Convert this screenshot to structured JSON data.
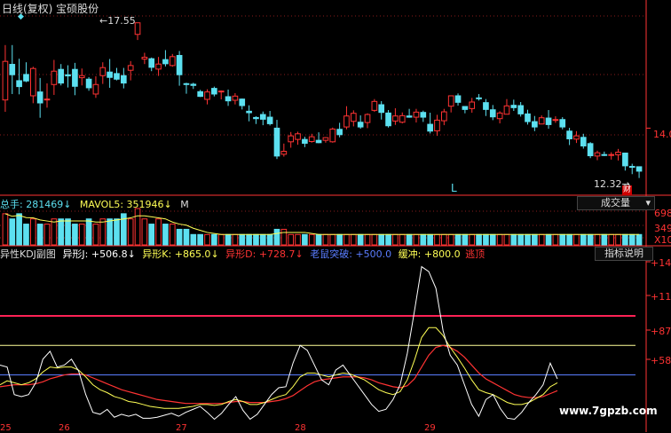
{
  "chart_title": "日线(复权)  宝硕股份",
  "price": {
    "high_label": "17.55",
    "low_label": "12.32",
    "axis_value": "14.0",
    "axis_values": [
      14.0
    ],
    "ylim": [
      11.8,
      17.9
    ],
    "marker_cai": "财",
    "marker_l": "L"
  },
  "volume": {
    "legend_total": "总手: 281469",
    "legend_mavol5": "MAVOL5: 351946",
    "legend_m": "M",
    "button": "成交量",
    "axis": [
      "698",
      "349",
      "X10"
    ]
  },
  "indicator": {
    "title": "异性KDJ副图",
    "legend": [
      {
        "text": "异形J: +506.8",
        "color": "#ffffff"
      },
      {
        "text": "异形K: +865.0",
        "color": "#ffff55"
      },
      {
        "text": "异形D: +728.7",
        "color": "#ff3333"
      },
      {
        "text": "老鼠突破: +500.0",
        "color": "#5a7dff"
      },
      {
        "text": "缓冲: +800.0",
        "color": "#ffff55"
      },
      {
        "text": "逃顶",
        "color": "#ff3333"
      }
    ],
    "button": "指标说明",
    "axis": [
      "+14",
      "+11",
      "+87",
      "+58"
    ]
  },
  "x_axis": [
    "25",
    "26",
    "27",
    "28",
    "29"
  ],
  "watermark": "www.7gpzb.com",
  "colors": {
    "up": "#ff3333",
    "down": "#5ce0f0",
    "grid": "#8a1c1c",
    "axis": "#ff3333"
  },
  "candles": [
    [
      14.95,
      16.25,
      14.55,
      16.8
    ],
    [
      16.15,
      15.8,
      15.15,
      16.8
    ],
    [
      15.6,
      15.4,
      15.14,
      16.34
    ],
    [
      15.81,
      15.59,
      15.55,
      16.22
    ],
    [
      15.09,
      16.01,
      14.84,
      16.07
    ],
    [
      15.22,
      14.85,
      14.35,
      15.69
    ],
    [
      14.95,
      14.98,
      14.69,
      15.51
    ],
    [
      15.47,
      15.92,
      15.12,
      16.3
    ],
    [
      15.98,
      15.52,
      15.44,
      16.16
    ],
    [
      15.8,
      15.76,
      15.37,
      16.12
    ],
    [
      15.98,
      15.41,
      15.11,
      16.2
    ],
    [
      15.7,
      15.77,
      15.44,
      16.01
    ],
    [
      15.65,
      15.36,
      15.26,
      15.72
    ],
    [
      15.15,
      15.47,
      15.02,
      15.75
    ],
    [
      15.77,
      16.04,
      15.49,
      16.22
    ],
    [
      15.89,
      15.71,
      15.36,
      16.33
    ],
    [
      15.84,
      15.65,
      15.61,
      16.03
    ],
    [
      15.77,
      15.52,
      15.34,
      16.03
    ],
    [
      15.95,
      16.11,
      15.61,
      16.26
    ],
    [
      17.16,
      17.55,
      16.97,
      17.55
    ],
    [
      16.33,
      16.39,
      16.16,
      16.54
    ],
    [
      16.34,
      16.05,
      15.92,
      16.38
    ],
    [
      15.99,
      16.16,
      15.76,
      16.4
    ],
    [
      16.31,
      16.17,
      16.08,
      16.63
    ],
    [
      16.11,
      16.41,
      16.07,
      16.5
    ],
    [
      16.45,
      15.8,
      15.43,
      16.6
    ],
    [
      15.5,
      15.47,
      15.16,
      15.53
    ],
    [
      15.48,
      15.44,
      15.32,
      15.53
    ],
    [
      15.23,
      15.07,
      15.05,
      15.29
    ],
    [
      14.97,
      15.22,
      14.8,
      15.31
    ],
    [
      15.34,
      15.15,
      15.07,
      15.4
    ],
    [
      15.22,
      15.25,
      14.97,
      15.27
    ],
    [
      15.06,
      14.92,
      14.75,
      15.3
    ],
    [
      14.94,
      15.08,
      14.8,
      15.18
    ],
    [
      14.98,
      14.76,
      14.63,
      15.0
    ],
    [
      14.57,
      14.52,
      14.23,
      14.77
    ],
    [
      14.36,
      14.32,
      14.14,
      14.4
    ],
    [
      14.46,
      14.3,
      14.1,
      14.56
    ],
    [
      14.37,
      14.15,
      14.09,
      14.58
    ],
    [
      14.0,
      13.06,
      12.96,
      14.28
    ],
    [
      13.12,
      13.22,
      13.04,
      13.48
    ],
    [
      13.54,
      13.74,
      13.34,
      13.87
    ],
    [
      13.62,
      13.81,
      13.44,
      13.88
    ],
    [
      13.62,
      13.49,
      13.36,
      13.71
    ],
    [
      13.55,
      13.71,
      13.51,
      13.81
    ],
    [
      13.59,
      13.51,
      13.49,
      13.86
    ],
    [
      13.59,
      13.68,
      13.51,
      13.7
    ],
    [
      13.54,
      13.97,
      13.51,
      14.02
    ],
    [
      13.96,
      13.78,
      13.69,
      14.18
    ],
    [
      14.04,
      14.41,
      13.96,
      14.74
    ],
    [
      14.23,
      14.5,
      14.06,
      14.6
    ],
    [
      14.2,
      14.04,
      13.98,
      14.43
    ],
    [
      14.19,
      14.46,
      14.0,
      14.5
    ],
    [
      14.6,
      14.9,
      14.55,
      14.98
    ],
    [
      14.79,
      14.53,
      14.29,
      14.91
    ],
    [
      14.51,
      14.08,
      14.02,
      14.61
    ],
    [
      14.24,
      14.41,
      14.11,
      14.67
    ],
    [
      14.2,
      14.42,
      14.16,
      14.53
    ],
    [
      14.41,
      14.37,
      14.35,
      14.65
    ],
    [
      14.37,
      14.54,
      14.19,
      14.65
    ],
    [
      14.53,
      14.37,
      14.21,
      14.59
    ],
    [
      14.13,
      13.9,
      13.82,
      14.52
    ],
    [
      13.91,
      14.27,
      13.74,
      14.45
    ],
    [
      14.25,
      14.55,
      14.1,
      14.65
    ],
    [
      14.74,
      15.09,
      14.53,
      15.09
    ],
    [
      15.09,
      14.87,
      14.76,
      15.17
    ],
    [
      14.73,
      14.63,
      14.5,
      14.74
    ],
    [
      14.66,
      14.88,
      14.52,
      15.02
    ],
    [
      15.02,
      14.99,
      14.93,
      15.15
    ],
    [
      14.86,
      14.63,
      14.41,
      14.98
    ],
    [
      14.62,
      14.38,
      14.27,
      14.78
    ],
    [
      14.32,
      14.51,
      14.16,
      14.57
    ],
    [
      14.47,
      14.75,
      14.46,
      14.98
    ],
    [
      14.77,
      14.69,
      14.58,
      14.96
    ],
    [
      14.76,
      14.48,
      14.39,
      14.88
    ],
    [
      14.48,
      14.22,
      14.12,
      14.62
    ],
    [
      14.22,
      14.04,
      13.9,
      14.41
    ],
    [
      14.14,
      14.35,
      14.13,
      14.43
    ],
    [
      14.34,
      14.12,
      13.98,
      14.61
    ],
    [
      14.27,
      14.29,
      14.18,
      14.4
    ],
    [
      14.29,
      14.04,
      13.96,
      14.37
    ],
    [
      13.9,
      13.64,
      13.43,
      14.01
    ],
    [
      13.63,
      13.74,
      13.5,
      13.9
    ],
    [
      13.69,
      13.4,
      13.31,
      13.81
    ],
    [
      13.48,
      13.07,
      12.99,
      13.53
    ],
    [
      13.06,
      13.17,
      12.92,
      13.24
    ],
    [
      13.11,
      13.1,
      13.06,
      13.21
    ],
    [
      13.1,
      13.11,
      12.94,
      13.19
    ],
    [
      13.1,
      13.19,
      12.91,
      13.3
    ],
    [
      13.16,
      12.73,
      12.57,
      13.17
    ],
    [
      12.71,
      12.68,
      12.45,
      12.8
    ],
    [
      12.7,
      12.55,
      12.32,
      12.71
    ]
  ],
  "vol_series": [
    6,
    5,
    6,
    4,
    5,
    4,
    4,
    5,
    5,
    5,
    4,
    4,
    5,
    4,
    5,
    5,
    5,
    6,
    5,
    7,
    5,
    4,
    5,
    4,
    4,
    3,
    3,
    2,
    2,
    2,
    2,
    2,
    2,
    2,
    2,
    2,
    2,
    2,
    2,
    3,
    3,
    2,
    2,
    2,
    2,
    2,
    2,
    2,
    2,
    2,
    2,
    2,
    2,
    2,
    2,
    2,
    2,
    2,
    2,
    2,
    2,
    2,
    2,
    2,
    2,
    2,
    2,
    2,
    2,
    2,
    2,
    2,
    2,
    2,
    2,
    2,
    2,
    2,
    2,
    2,
    2,
    2,
    2,
    2,
    2,
    2,
    2,
    2,
    2,
    2,
    2,
    2
  ],
  "kdj": {
    "j": [
      0.6,
      0.58,
      0.3,
      0.28,
      0.3,
      0.42,
      0.66,
      0.74,
      0.58,
      0.6,
      0.66,
      0.54,
      0.3,
      0.12,
      0.1,
      0.15,
      0.07,
      0.1,
      0.08,
      0.1,
      0.06,
      0.06,
      0.07,
      0.09,
      0.11,
      0.08,
      0.12,
      0.15,
      0.18,
      0.12,
      0.05,
      0.11,
      0.2,
      0.28,
      0.14,
      0.05,
      0.1,
      0.2,
      0.3,
      0.37,
      0.38,
      0.62,
      0.8,
      0.75,
      0.6,
      0.45,
      0.4,
      0.55,
      0.6,
      0.5,
      0.4,
      0.3,
      0.2,
      0.13,
      0.15,
      0.25,
      0.4,
      0.72,
      1.15,
      1.6,
      1.55,
      1.38,
      0.95,
      0.7,
      0.6,
      0.4,
      0.2,
      0.08,
      0.25,
      0.3,
      0.16,
      0.06,
      0.05,
      0.12,
      0.22,
      0.3,
      0.4,
      0.62,
      0.46
    ],
    "k": [
      0.4,
      0.44,
      0.42,
      0.4,
      0.42,
      0.46,
      0.53,
      0.58,
      0.57,
      0.58,
      0.58,
      0.55,
      0.48,
      0.4,
      0.35,
      0.32,
      0.28,
      0.26,
      0.23,
      0.22,
      0.2,
      0.18,
      0.17,
      0.16,
      0.16,
      0.16,
      0.17,
      0.18,
      0.2,
      0.2,
      0.19,
      0.2,
      0.23,
      0.25,
      0.23,
      0.2,
      0.2,
      0.22,
      0.25,
      0.28,
      0.3,
      0.38,
      0.48,
      0.52,
      0.52,
      0.5,
      0.48,
      0.5,
      0.52,
      0.51,
      0.48,
      0.45,
      0.4,
      0.35,
      0.32,
      0.3,
      0.33,
      0.45,
      0.65,
      0.88,
      0.98,
      0.98,
      0.9,
      0.78,
      0.68,
      0.57,
      0.45,
      0.35,
      0.32,
      0.3,
      0.26,
      0.22,
      0.2,
      0.2,
      0.22,
      0.26,
      0.3,
      0.38,
      0.42
    ],
    "d": [
      0.38,
      0.39,
      0.4,
      0.4,
      0.4,
      0.41,
      0.43,
      0.46,
      0.48,
      0.5,
      0.51,
      0.51,
      0.5,
      0.47,
      0.44,
      0.41,
      0.38,
      0.35,
      0.33,
      0.31,
      0.29,
      0.27,
      0.25,
      0.24,
      0.23,
      0.22,
      0.21,
      0.21,
      0.21,
      0.21,
      0.21,
      0.21,
      0.22,
      0.23,
      0.23,
      0.22,
      0.22,
      0.22,
      0.23,
      0.24,
      0.26,
      0.29,
      0.34,
      0.39,
      0.43,
      0.45,
      0.46,
      0.47,
      0.48,
      0.48,
      0.48,
      0.47,
      0.45,
      0.42,
      0.4,
      0.38,
      0.37,
      0.39,
      0.46,
      0.58,
      0.7,
      0.78,
      0.8,
      0.78,
      0.74,
      0.68,
      0.6,
      0.52,
      0.46,
      0.42,
      0.38,
      0.34,
      0.3,
      0.28,
      0.27,
      0.27,
      0.28,
      0.31,
      0.34
    ],
    "levels": {
      "top": 1.1,
      "buffer": 0.8,
      "breakout": 0.5
    }
  }
}
